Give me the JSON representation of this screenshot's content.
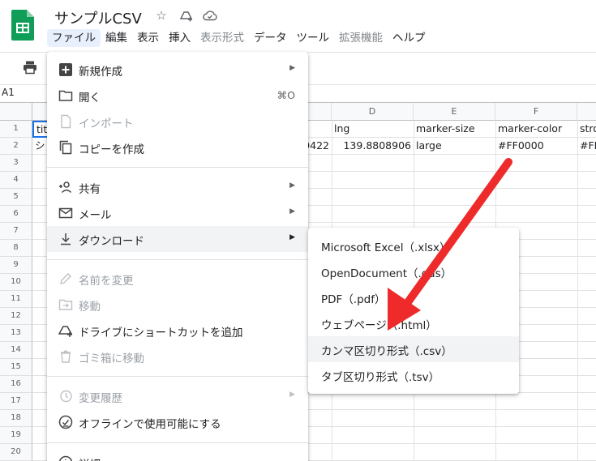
{
  "app": {
    "title": "サンプルCSV",
    "brand_color": "#0F9D58"
  },
  "menubar": [
    "ファイル",
    "編集",
    "表示",
    "挿入",
    "表示形式",
    "データ",
    "ツール",
    "拡張機能",
    "ヘルプ"
  ],
  "name_box": "A1",
  "grid": {
    "columns": [
      "D",
      "E",
      "F"
    ],
    "rows": [
      "1",
      "2",
      "3",
      "4",
      "5",
      "6",
      "7",
      "8",
      "9",
      "10",
      "11",
      "12",
      "13",
      "14",
      "15",
      "16",
      "17",
      "18",
      "19",
      "20"
    ],
    "row1": {
      "a": "title",
      "d": "lng",
      "e": "marker-size",
      "f": "marker-color",
      "g": "stro"
    },
    "row2": {
      "a": "シ",
      "c": "9422",
      "d": "139.8808906",
      "e": "large",
      "f": "#FF0000",
      "g": "#FF"
    }
  },
  "file_menu": {
    "items": [
      {
        "label": "新規作成",
        "icon": "plus-box-icon",
        "submenu": true
      },
      {
        "label": "開く",
        "icon": "folder-icon",
        "shortcut": "⌘O"
      },
      {
        "label": "インポート",
        "icon": "file-icon",
        "disabled": true
      },
      {
        "label": "コピーを作成",
        "icon": "copy-icon"
      },
      {
        "label": "共有",
        "icon": "person-add-icon",
        "submenu": true
      },
      {
        "label": "メール",
        "icon": "mail-icon",
        "submenu": true
      },
      {
        "label": "ダウンロード",
        "icon": "download-icon",
        "submenu": true,
        "active": true
      },
      {
        "label": "名前を変更",
        "icon": "rename-icon",
        "disabled": true
      },
      {
        "label": "移動",
        "icon": "move-folder-icon",
        "disabled": true
      },
      {
        "label": "ドライブにショートカットを追加",
        "icon": "drive-shortcut-icon"
      },
      {
        "label": "ゴミ箱に移動",
        "icon": "trash-icon",
        "disabled": true
      },
      {
        "label": "変更履歴",
        "icon": "history-icon",
        "submenu": true,
        "disabled": true
      },
      {
        "label": "オフラインで使用可能にする",
        "icon": "offline-icon"
      },
      {
        "label": "詳細",
        "icon": "info-icon"
      }
    ]
  },
  "download_submenu": {
    "items": [
      {
        "label": "Microsoft Excel（.xlsx）"
      },
      {
        "label": "OpenDocument（.ods）"
      },
      {
        "label": "PDF（.pdf）"
      },
      {
        "label": "ウェブページ（.html）"
      },
      {
        "label": "カンマ区切り形式（.csv）",
        "active": true
      },
      {
        "label": "タブ区切り形式（.tsv）"
      }
    ]
  },
  "annotation": {
    "arrow_color": "#EE2A2A"
  }
}
